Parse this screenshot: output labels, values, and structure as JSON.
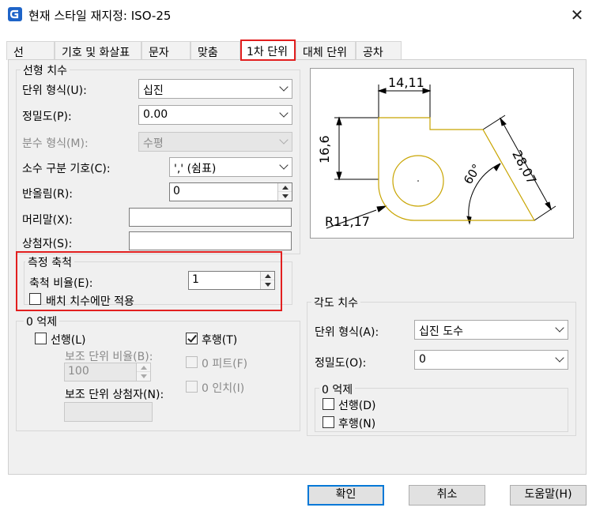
{
  "window": {
    "title": "현재 스타일 재지정: ISO-25",
    "close_glyph": "✕"
  },
  "tabs": [
    "선",
    "기호 및 화살표",
    "문자",
    "맞춤",
    "1차 단위",
    "대체 단위",
    "공차"
  ],
  "linear": {
    "group_label": "선형 치수",
    "unit_format_label": "단위 형식(U):",
    "unit_format_value": "십진",
    "precision_label": "정밀도(P):",
    "precision_value": "0.00",
    "fraction_label": "분수 형식(M):",
    "fraction_value": "수평",
    "decimal_sep_label": "소수 구분 기호(C):",
    "decimal_sep_value": "',' (쉼표)",
    "round_label": "반올림(R):",
    "round_value": "0",
    "prefix_label": "머리말(X):",
    "prefix_value": "",
    "suffix_label": "상첨자(S):",
    "suffix_value": ""
  },
  "scale": {
    "group_label": "측정 축척",
    "factor_label": "축척 비율(E):",
    "factor_value": "1",
    "layout_only_label": "배치 치수에만 적용"
  },
  "zero_left": {
    "group_label": "0 억제",
    "leading_label": "선행(L)",
    "trailing_label": "후행(T)",
    "sub_factor_label": "보조 단위 비율(B):",
    "sub_factor_value": "100",
    "feet_label": "0 피트(F)",
    "inches_label": "0 인치(I)",
    "sub_suffix_label": "보조 단위 상첨자(N):",
    "sub_suffix_value": ""
  },
  "angular": {
    "group_label": "각도 치수",
    "unit_format_label": "단위 형식(A):",
    "unit_format_value": "십진 도수",
    "precision_label": "정밀도(O):",
    "precision_value": "0",
    "zero_group_label": "0 억제",
    "leading_label": "선행(D)",
    "trailing_label": "후행(N)"
  },
  "preview": {
    "dim_top": "14,11",
    "dim_left": "16,6",
    "dim_diag": "28,07",
    "dim_angle": "60°",
    "dim_radius": "R11,17"
  },
  "buttons": {
    "ok": "확인",
    "cancel": "취소",
    "help": "도움말(H)"
  },
  "colors": {
    "highlight": "#e21f1f",
    "focus": "#0078d7",
    "drawing_outline": "#c8a400"
  }
}
